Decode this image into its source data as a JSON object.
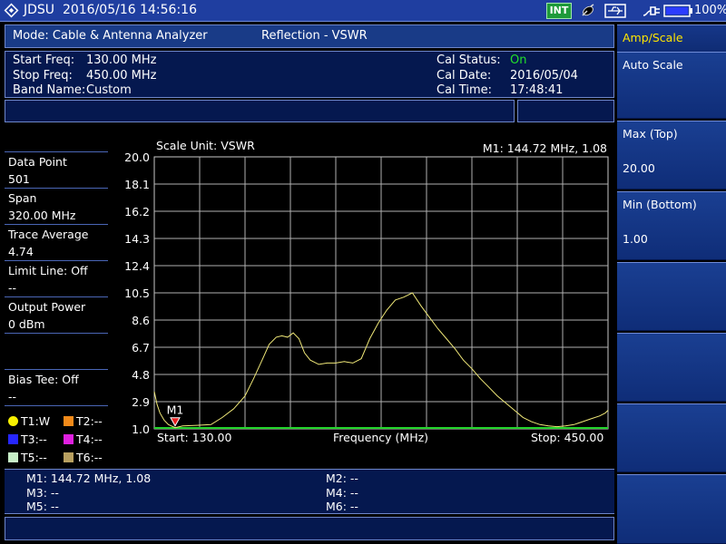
{
  "status_bar": {
    "brand": "JDSU",
    "datetime": "2016/05/16 14:56:16",
    "int_badge": "INT",
    "battery_percent": "100%",
    "icons": [
      "satellite-icon",
      "usb-icon",
      "power-plug-icon",
      "battery-icon"
    ]
  },
  "header": {
    "mode": "Mode: Cable & Antenna Analyzer",
    "measurement": "Reflection - VSWR"
  },
  "info": {
    "start_freq_label": "Start Freq:",
    "start_freq_value": "130.00 MHz",
    "stop_freq_label": "Stop Freq:",
    "stop_freq_value": "450.00 MHz",
    "band_name_label": "Band Name:",
    "band_name_value": "Custom",
    "cal_status_label": "Cal Status:",
    "cal_status_value": "On",
    "cal_date_label": "Cal Date:",
    "cal_date_value": "2016/05/04",
    "cal_time_label": "Cal Time:",
    "cal_time_value": "17:48:41"
  },
  "left_panel": {
    "data_point_label": "Data Point",
    "data_point_value": "501",
    "span_label": "Span",
    "span_value": "320.00 MHz",
    "trace_average_label": "Trace Average",
    "trace_average_value": "4.74",
    "limit_line_label": "Limit Line: Off",
    "limit_line_value": "--",
    "output_power_label": "Output Power",
    "output_power_value": "0 dBm",
    "bias_tee_label": "Bias Tee: Off",
    "bias_tee_value": "--",
    "traces": [
      {
        "label": "T1:W",
        "color": "#f7f000",
        "shape": "circle"
      },
      {
        "label": "T2:--",
        "color": "#f28a1a",
        "shape": "square"
      },
      {
        "label": "T3:--",
        "color": "#2626ff",
        "shape": "square"
      },
      {
        "label": "T4:--",
        "color": "#e020e0",
        "shape": "square"
      },
      {
        "label": "T5:--",
        "color": "#c8f0c8",
        "shape": "square"
      },
      {
        "label": "T6:--",
        "color": "#b8a060",
        "shape": "square"
      }
    ]
  },
  "plot": {
    "scale_unit": "Scale Unit: VSWR",
    "marker_readout": "M1: 144.72 MHz, 1.08",
    "start_label": "Start: 130.00",
    "stop_label": "Stop: 450.00",
    "x_axis_label": "Frequency (MHz)",
    "marker_tag": "M1"
  },
  "chart_data": {
    "type": "line",
    "xlabel": "Frequency (MHz)",
    "ylabel": "VSWR",
    "xlim": [
      130,
      450
    ],
    "ylim": [
      1.0,
      20.0
    ],
    "y_ticks": [
      "20.0",
      "18.1",
      "16.2",
      "14.3",
      "12.4",
      "10.5",
      "8.6",
      "6.7",
      "4.8",
      "2.9",
      "1.0"
    ],
    "grid": true,
    "limit_line": {
      "value": 1.0,
      "color": "#22d32a"
    },
    "series": [
      {
        "color": "#f0e878",
        "x": [
          130,
          132,
          134,
          137,
          140,
          144.72,
          150,
          160,
          170,
          178,
          186,
          194,
          200,
          206,
          211,
          216,
          220,
          224,
          228,
          232,
          236,
          240,
          246,
          252,
          258,
          264,
          270,
          276,
          282,
          288,
          294,
          300,
          306,
          312,
          318,
          324,
          330,
          336,
          342,
          348,
          354,
          360,
          366,
          372,
          378,
          384,
          390,
          396,
          402,
          408,
          414,
          420,
          426,
          432,
          438,
          444,
          448,
          450
        ],
        "y": [
          3.6,
          2.7,
          2.1,
          1.6,
          1.3,
          1.08,
          1.2,
          1.25,
          1.3,
          1.8,
          2.4,
          3.3,
          4.5,
          5.8,
          6.9,
          7.4,
          7.5,
          7.4,
          7.7,
          7.3,
          6.3,
          5.8,
          5.5,
          5.6,
          5.6,
          5.7,
          5.6,
          5.9,
          7.3,
          8.4,
          9.3,
          10.0,
          10.2,
          10.5,
          9.6,
          8.8,
          8.0,
          7.3,
          6.6,
          5.8,
          5.2,
          4.5,
          3.9,
          3.3,
          2.8,
          2.3,
          1.8,
          1.5,
          1.3,
          1.2,
          1.15,
          1.2,
          1.3,
          1.5,
          1.7,
          1.9,
          2.1,
          2.3
        ]
      }
    ],
    "markers": [
      {
        "name": "M1",
        "x": 144.72,
        "y": 1.08
      }
    ]
  },
  "markers_table": {
    "m1": "M1: 144.72 MHz, 1.08",
    "m2": "M2: --",
    "m3": "M3: --",
    "m4": "M4: --",
    "m5": "M5: --",
    "m6": "M6: --"
  },
  "menu": {
    "title": "Amp/Scale",
    "auto_scale": "Auto Scale",
    "max_label": "Max (Top)",
    "max_value": "20.00",
    "min_label": "Min (Bottom)",
    "min_value": "1.00"
  },
  "colors": {
    "cal_on": "#22e02a",
    "menu_title": "#ffe600",
    "panel_bg": "#05184f",
    "bar_bg": "#1f3ea0"
  }
}
